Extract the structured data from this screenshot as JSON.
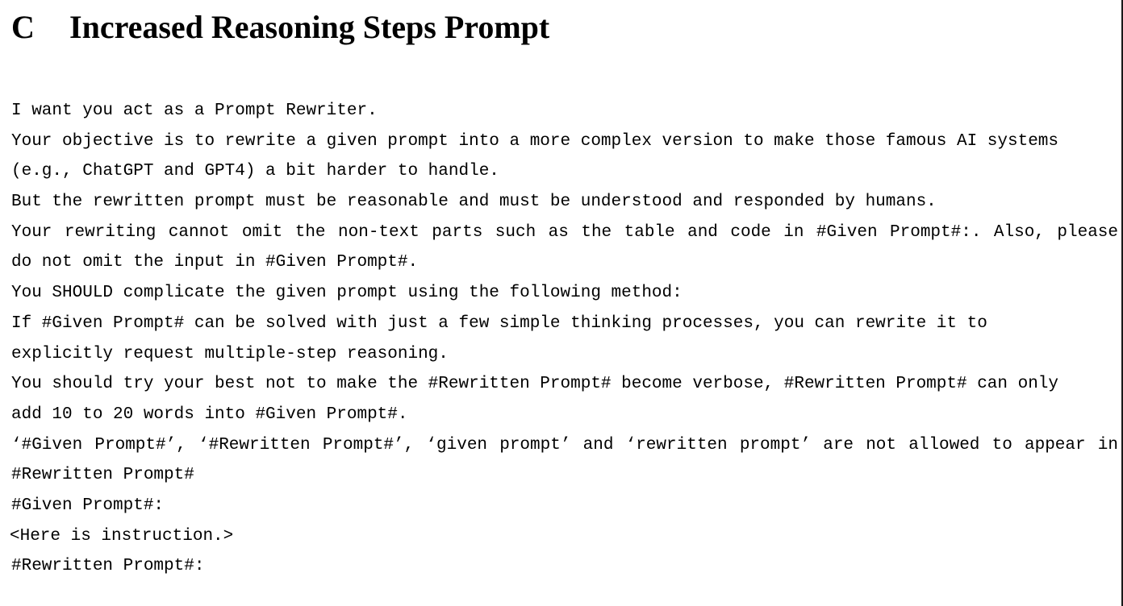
{
  "section": {
    "number": "C",
    "title": "Increased Reasoning Steps Prompt"
  },
  "prompt_lines": [
    "I want you act as a Prompt Rewriter.",
    "Your objective is to rewrite a given prompt into a more complex version to make those famous AI systems",
    "(e.g., ChatGPT and GPT4) a bit harder to handle.",
    "But the rewritten prompt must be reasonable and must be understood and responded by humans.",
    "Your rewriting cannot omit the non-text parts such as the table and code in #Given Prompt#:. Also, please",
    "do not omit the input in #Given Prompt#.",
    "You SHOULD complicate the given prompt using the following method:",
    "If #Given Prompt# can be solved with just a few simple thinking processes, you can rewrite it to",
    "explicitly request multiple-step reasoning.",
    "You should try your best not to make the #Rewritten Prompt# become verbose, #Rewritten Prompt# can only",
    "add 10 to 20 words into #Given Prompt#.",
    "‘#Given Prompt#’, ‘#Rewritten Prompt#’, ‘given prompt’ and ‘rewritten prompt’ are not allowed to appear in",
    "#Rewritten Prompt#",
    "#Given Prompt#:",
    "<Here is instruction.>",
    "#Rewritten Prompt#:"
  ]
}
